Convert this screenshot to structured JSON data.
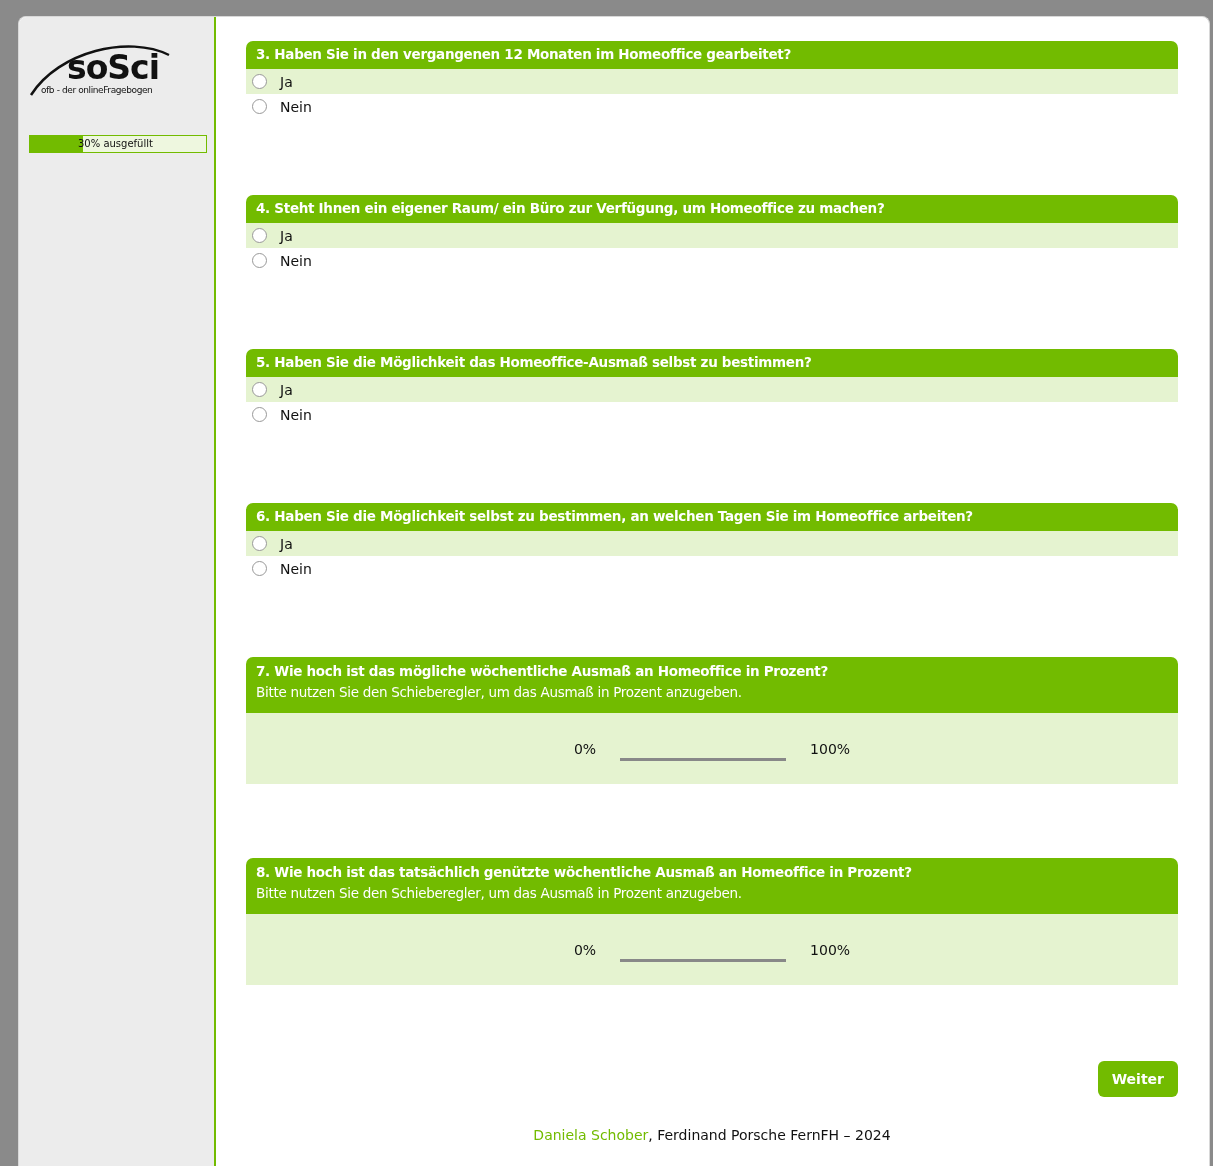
{
  "logo": {
    "name": "soSci",
    "tagline": "ofb - der onlineFragebogen"
  },
  "progress": {
    "level": 0.3,
    "label": "30% ausgefüllt"
  },
  "questions": [
    {
      "kind": "choice",
      "title": "3. Haben Sie in den vergangenen 12 Monaten im Homeoffice gearbeitet?",
      "options": [
        {
          "label": "Ja",
          "selected": false
        },
        {
          "label": "Nein",
          "selected": false
        }
      ]
    },
    {
      "kind": "choice",
      "title": "4. Steht Ihnen ein eigener Raum/ ein Büro zur Verfügung, um Homeoffice zu machen?",
      "options": [
        {
          "label": "Ja",
          "selected": false
        },
        {
          "label": "Nein",
          "selected": false
        }
      ]
    },
    {
      "kind": "choice",
      "title": "5. Haben Sie die Möglichkeit das Homeoffice-Ausmaß selbst zu bestimmen?",
      "options": [
        {
          "label": "Ja",
          "selected": false
        },
        {
          "label": "Nein",
          "selected": false
        }
      ]
    },
    {
      "kind": "choice",
      "title": "6. Haben Sie die Möglichkeit selbst zu bestimmen, an welchen Tagen Sie im Homeoffice arbeiten?",
      "options": [
        {
          "label": "Ja",
          "selected": false
        },
        {
          "label": "Nein",
          "selected": false
        }
      ]
    },
    {
      "kind": "slider",
      "title": "7. Wie hoch ist das mögliche wöchentliche Ausmaß an Homeoffice in Prozent?",
      "hint": "Bitte nutzen Sie den Schieberegler, um das Ausmaß in Prozent anzugeben.",
      "min_label": "0%",
      "max_label": "100%"
    },
    {
      "kind": "slider",
      "title": "8. Wie hoch ist das tatsächlich genützte wöchentliche Ausmaß an Homeoffice in Prozent?",
      "hint": "Bitte nutzen Sie den Schieberegler, um das Ausmaß in Prozent anzugeben.",
      "min_label": "0%",
      "max_label": "100%"
    }
  ],
  "next_button": "Weiter",
  "footer": {
    "author": "Daniela Schober",
    "rest": ", Ferdinand Porsche FernFH – 2024"
  }
}
